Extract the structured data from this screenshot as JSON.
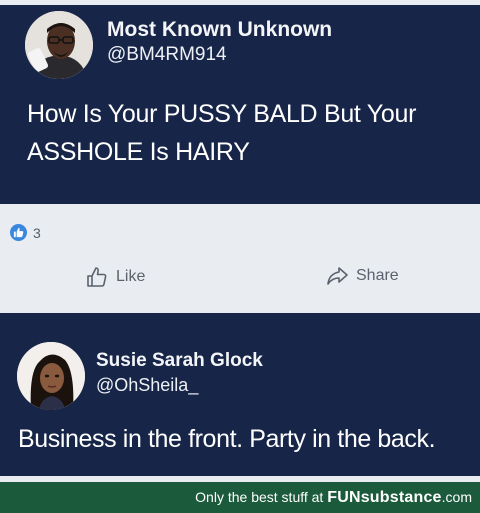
{
  "tweet1": {
    "name": "Most Known Unknown",
    "handle": "@BM4RM914",
    "body": "How Is Your PUSSY BALD But Your ASSHOLE Is HAIRY"
  },
  "facebook": {
    "like_count": "3",
    "like_label": "Like",
    "share_label": "Share"
  },
  "tweet2": {
    "name": "Susie Sarah Glock",
    "handle": "@OhSheila_",
    "body": "Business in the front. Party in the back."
  },
  "footer": {
    "text": "Only the best stuff at",
    "brand": "FUNsubstance",
    "domain": ".com"
  }
}
